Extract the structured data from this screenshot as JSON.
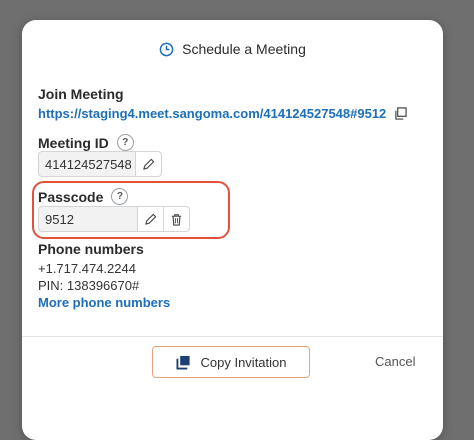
{
  "dialog": {
    "title": "Schedule a Meeting",
    "title_icon": "clock-icon"
  },
  "join": {
    "label": "Join Meeting",
    "url": "https://staging4.meet.sangoma.com/414124527548#9512",
    "copy_icon": "copy-icon"
  },
  "meeting_id": {
    "label": "Meeting ID",
    "help": "?",
    "value": "414124527548",
    "edit_icon": "pencil-icon"
  },
  "passcode": {
    "label": "Passcode",
    "help": "?",
    "value": "9512",
    "edit_icon": "pencil-icon",
    "delete_icon": "trash-icon",
    "highlight_color": "#e2513b"
  },
  "phone": {
    "label": "Phone numbers",
    "number": "+1.717.474.2244",
    "pin": "PIN: 138396670#",
    "more_link": "More phone numbers"
  },
  "footer": {
    "copy_button": "Copy Invitation",
    "copy_icon": "copy-stack-icon",
    "cancel_button": "Cancel"
  },
  "colors": {
    "accent": "#1d6fb8",
    "highlight": "#e2513b",
    "button_border": "#e8a27b",
    "overlay": "#6f6f6f"
  }
}
